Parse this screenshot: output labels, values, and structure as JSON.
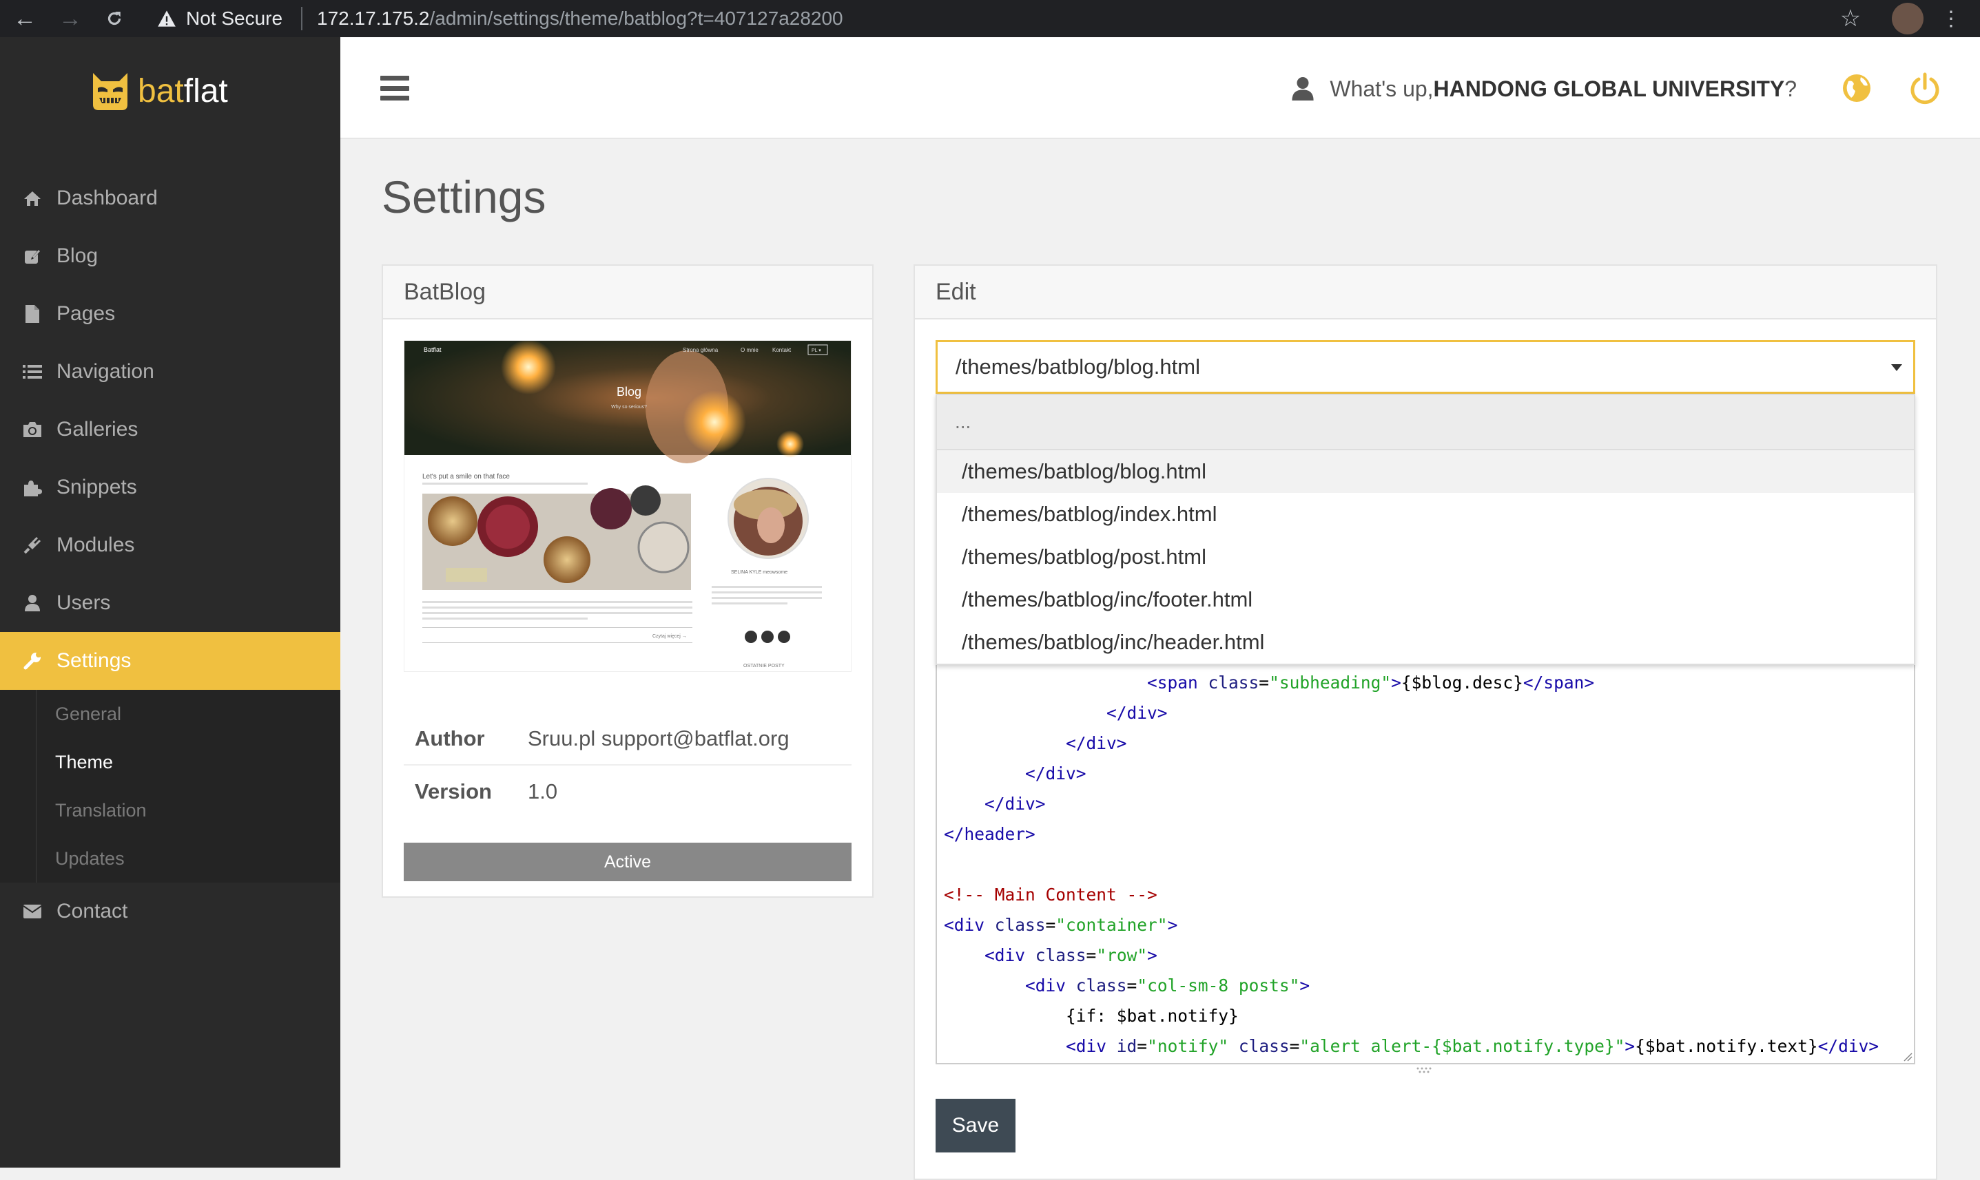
{
  "browser": {
    "not_secure_label": "Not Secure",
    "url_host": "172.17.175.2",
    "url_path": "/admin/settings/theme/batblog?t=407127a28200"
  },
  "brand": {
    "logo_part1": "bat",
    "logo_part2": "flat"
  },
  "sidebar": {
    "items": [
      {
        "label": "Dashboard",
        "icon": "home-icon"
      },
      {
        "label": "Blog",
        "icon": "edit-icon"
      },
      {
        "label": "Pages",
        "icon": "file-icon"
      },
      {
        "label": "Navigation",
        "icon": "list-icon"
      },
      {
        "label": "Galleries",
        "icon": "camera-icon"
      },
      {
        "label": "Snippets",
        "icon": "puzzle-icon"
      },
      {
        "label": "Modules",
        "icon": "plug-icon"
      },
      {
        "label": "Users",
        "icon": "user-icon"
      },
      {
        "label": "Settings",
        "icon": "wrench-icon"
      },
      {
        "label": "Contact",
        "icon": "envelope-icon"
      }
    ],
    "settings_sub": [
      "General",
      "Theme",
      "Translation",
      "Updates"
    ]
  },
  "header": {
    "greeting_prefix": "What's up, ",
    "user_name": "HANDONG GLOBAL UNIVERSITY",
    "greeting_suffix": "?"
  },
  "page": {
    "title": "Settings"
  },
  "theme_panel": {
    "title": "BatBlog",
    "author_label": "Author",
    "author_value": "Sruu.pl support@batflat.org",
    "version_label": "Version",
    "version_value": "1.0",
    "status_button": "Active",
    "preview": {
      "brand": "Batflat",
      "nav_1": "Strona główna",
      "nav_2": "O mnie",
      "nav_3": "Kontakt",
      "lang": "PL ▾",
      "hero_title": "Blog",
      "hero_sub": "Why so serious?",
      "post_title": "Let's put a smile on that face",
      "sidebar_name": "SELINA KYLE meowsome",
      "recent": "OSTATNIE POSTY",
      "more": "Czytaj więcej →"
    }
  },
  "edit_panel": {
    "title": "Edit",
    "selected_file": "/themes/batblog/blog.html",
    "search_placeholder": "...",
    "options": [
      "/themes/batblog/blog.html",
      "/themes/batblog/index.html",
      "/themes/batblog/post.html",
      "/themes/batblog/inc/footer.html",
      "/themes/batblog/inc/header.html"
    ],
    "code_lines": [
      {
        "indent": "                    ",
        "parts": [
          [
            "tg",
            "<span "
          ],
          [
            "at",
            "class"
          ],
          [
            "",
            "="
          ],
          [
            "st",
            "\"subheading\""
          ],
          [
            "tg",
            ">"
          ],
          [
            "",
            "{$blog.desc}"
          ],
          [
            "tg",
            "</span>"
          ]
        ]
      },
      {
        "indent": "                ",
        "parts": [
          [
            "tg",
            "</div>"
          ]
        ]
      },
      {
        "indent": "            ",
        "parts": [
          [
            "tg",
            "</div>"
          ]
        ]
      },
      {
        "indent": "        ",
        "parts": [
          [
            "tg",
            "</div>"
          ]
        ]
      },
      {
        "indent": "    ",
        "parts": [
          [
            "tg",
            "</div>"
          ]
        ]
      },
      {
        "indent": "",
        "parts": [
          [
            "tg",
            "</header>"
          ]
        ]
      },
      {
        "indent": "",
        "parts": []
      },
      {
        "indent": "",
        "parts": [
          [
            "cm",
            "<!-- Main Content -->"
          ]
        ]
      },
      {
        "indent": "",
        "parts": [
          [
            "tg",
            "<div "
          ],
          [
            "at",
            "class"
          ],
          [
            "",
            "="
          ],
          [
            "st",
            "\"container\""
          ],
          [
            "tg",
            ">"
          ]
        ]
      },
      {
        "indent": "    ",
        "parts": [
          [
            "tg",
            "<div "
          ],
          [
            "at",
            "class"
          ],
          [
            "",
            "="
          ],
          [
            "st",
            "\"row\""
          ],
          [
            "tg",
            ">"
          ]
        ]
      },
      {
        "indent": "        ",
        "parts": [
          [
            "tg",
            "<div "
          ],
          [
            "at",
            "class"
          ],
          [
            "",
            "="
          ],
          [
            "st",
            "\"col-sm-8 posts\""
          ],
          [
            "tg",
            ">"
          ]
        ]
      },
      {
        "indent": "            ",
        "parts": [
          [
            "",
            "{if: $bat.notify}"
          ]
        ]
      },
      {
        "indent": "            ",
        "parts": [
          [
            "tg",
            "<div "
          ],
          [
            "at",
            "id"
          ],
          [
            "",
            "="
          ],
          [
            "st",
            "\"notify\""
          ],
          [
            "",
            " "
          ],
          [
            "at",
            "class"
          ],
          [
            "",
            "="
          ],
          [
            "st",
            "\"alert alert-{$bat.notify.type}\""
          ],
          [
            "tg",
            ">"
          ],
          [
            "",
            "{$bat.notify.text}"
          ],
          [
            "tg",
            "</div>"
          ]
        ]
      }
    ],
    "save_label": "Save"
  },
  "colors": {
    "accent": "#f0c040",
    "sidebar_bg": "#2a2a2a",
    "save_bg": "#3e4a54"
  }
}
